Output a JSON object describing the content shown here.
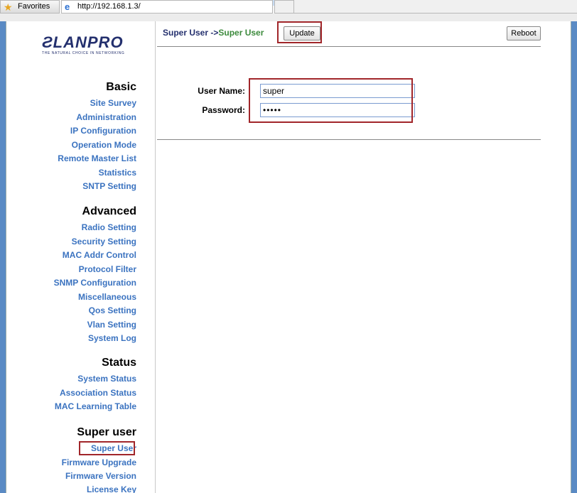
{
  "browser": {
    "favorites_label": "Favorites",
    "url": "http://192.168.1.3/"
  },
  "logo": {
    "text": "ƧLANPRO",
    "tagline": "THE NATURAL CHOICE IN NETWORKING"
  },
  "nav": {
    "basic": {
      "title": "Basic",
      "items": [
        "Site Survey",
        "Administration",
        "IP Configuration",
        "Operation Mode",
        "Remote Master List",
        "Statistics",
        "SNTP Setting"
      ]
    },
    "advanced": {
      "title": "Advanced",
      "items": [
        "Radio Setting",
        "Security Setting",
        "MAC Addr Control",
        "Protocol Filter",
        "SNMP Configuration",
        "Miscellaneous",
        "Qos Setting",
        "Vlan Setting",
        "System Log"
      ]
    },
    "status": {
      "title": "Status",
      "items": [
        "System Status",
        "Association Status",
        "MAC Learning Table"
      ]
    },
    "superuser": {
      "title": "Super user",
      "items": [
        "Super User",
        "Firmware Upgrade",
        "Firmware Version",
        "License Key"
      ]
    }
  },
  "content": {
    "breadcrumb_prefix": "Super User ->",
    "breadcrumb_current": "Super User",
    "update_label": "Update",
    "reboot_label": "Reboot",
    "username_label": "User Name:",
    "username_value": "super",
    "password_label": "Password:",
    "password_value": "super"
  },
  "colors": {
    "link": "#3b73c0",
    "highlight": "#a1262a",
    "breadcrumb_current": "#3c8a3c",
    "frame_background": "#5a8ac4"
  }
}
